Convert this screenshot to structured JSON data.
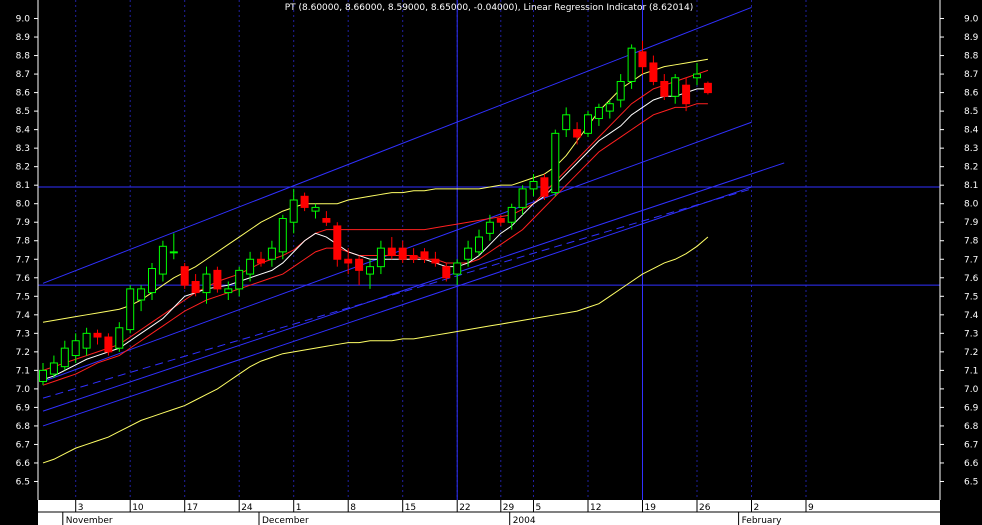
{
  "chart_data": {
    "type": "candlestick",
    "title": "PT (8.60000, 8.66000, 8.59000, 8.65000, -0.04000), Linear Regression Indicator (8.62014)",
    "ylim": [
      6.4,
      9.1
    ],
    "yticks": [
      6.5,
      6.6,
      6.7,
      6.8,
      6.9,
      7.0,
      7.1,
      7.2,
      7.3,
      7.4,
      7.5,
      7.6,
      7.7,
      7.8,
      7.9,
      8.0,
      8.1,
      8.2,
      8.3,
      8.4,
      8.5,
      8.6,
      8.7,
      8.8,
      8.9,
      9.0
    ],
    "ytick_labels": [
      "6.5",
      "6.6",
      "6.7",
      "6.8",
      "6.9",
      "7.0",
      "7.1",
      "7.2",
      "7.3",
      "7.4",
      "7.5",
      "7.6",
      "7.7",
      "7.8",
      "7.9",
      "8.0",
      "8.1",
      "8.2",
      "8.3",
      "8.4",
      "8.5",
      "8.6",
      "8.7",
      "8.8",
      "8.9",
      "9.0"
    ],
    "x_ticks": [
      {
        "label": "3",
        "index": 3
      },
      {
        "label": "10",
        "index": 8
      },
      {
        "label": "17",
        "index": 13
      },
      {
        "label": "24",
        "index": 18
      },
      {
        "label": "1",
        "index": 23
      },
      {
        "label": "8",
        "index": 28
      },
      {
        "label": "15",
        "index": 33
      },
      {
        "label": "22",
        "index": 38
      },
      {
        "label": "29",
        "index": 42
      },
      {
        "label": "5",
        "index": 45
      },
      {
        "label": "12",
        "index": 50
      },
      {
        "label": "19",
        "index": 55
      },
      {
        "label": "26",
        "index": 60
      },
      {
        "label": "2",
        "index": 65
      },
      {
        "label": "9",
        "index": 70
      }
    ],
    "months": [
      {
        "label": "November",
        "index": 2
      },
      {
        "label": "December",
        "index": 20
      },
      {
        "label": "2004",
        "index": 43
      },
      {
        "label": "February",
        "index": 64
      }
    ],
    "candles": [
      {
        "o": 7.04,
        "h": 7.14,
        "l": 7.02,
        "c": 7.1
      },
      {
        "o": 7.08,
        "h": 7.18,
        "l": 7.06,
        "c": 7.14
      },
      {
        "o": 7.12,
        "h": 7.26,
        "l": 7.1,
        "c": 7.22
      },
      {
        "o": 7.18,
        "h": 7.3,
        "l": 7.14,
        "c": 7.26
      },
      {
        "o": 7.22,
        "h": 7.33,
        "l": 7.18,
        "c": 7.3
      },
      {
        "o": 7.3,
        "h": 7.32,
        "l": 7.24,
        "c": 7.28
      },
      {
        "o": 7.28,
        "h": 7.3,
        "l": 7.18,
        "c": 7.2
      },
      {
        "o": 7.22,
        "h": 7.36,
        "l": 7.2,
        "c": 7.33
      },
      {
        "o": 7.32,
        "h": 7.56,
        "l": 7.3,
        "c": 7.54
      },
      {
        "o": 7.48,
        "h": 7.56,
        "l": 7.42,
        "c": 7.54
      },
      {
        "o": 7.52,
        "h": 7.68,
        "l": 7.48,
        "c": 7.65
      },
      {
        "o": 7.62,
        "h": 7.8,
        "l": 7.58,
        "c": 7.77
      },
      {
        "o": 7.74,
        "h": 7.84,
        "l": 7.7,
        "c": 7.74
      },
      {
        "o": 7.66,
        "h": 7.68,
        "l": 7.54,
        "c": 7.56
      },
      {
        "o": 7.58,
        "h": 7.62,
        "l": 7.5,
        "c": 7.52
      },
      {
        "o": 7.52,
        "h": 7.66,
        "l": 7.46,
        "c": 7.62
      },
      {
        "o": 7.64,
        "h": 7.66,
        "l": 7.52,
        "c": 7.54
      },
      {
        "o": 7.52,
        "h": 7.58,
        "l": 7.48,
        "c": 7.54
      },
      {
        "o": 7.54,
        "h": 7.66,
        "l": 7.5,
        "c": 7.64
      },
      {
        "o": 7.62,
        "h": 7.74,
        "l": 7.58,
        "c": 7.7
      },
      {
        "o": 7.7,
        "h": 7.74,
        "l": 7.66,
        "c": 7.68
      },
      {
        "o": 7.7,
        "h": 7.8,
        "l": 7.66,
        "c": 7.76
      },
      {
        "o": 7.74,
        "h": 7.94,
        "l": 7.7,
        "c": 7.92
      },
      {
        "o": 7.9,
        "h": 8.08,
        "l": 7.84,
        "c": 8.02
      },
      {
        "o": 8.04,
        "h": 8.06,
        "l": 7.96,
        "c": 7.98
      },
      {
        "o": 7.96,
        "h": 8.0,
        "l": 7.92,
        "c": 7.98
      },
      {
        "o": 7.92,
        "h": 7.96,
        "l": 7.88,
        "c": 7.9
      },
      {
        "o": 7.88,
        "h": 7.9,
        "l": 7.66,
        "c": 7.7
      },
      {
        "o": 7.7,
        "h": 7.76,
        "l": 7.62,
        "c": 7.68
      },
      {
        "o": 7.7,
        "h": 7.72,
        "l": 7.56,
        "c": 7.64
      },
      {
        "o": 7.62,
        "h": 7.7,
        "l": 7.54,
        "c": 7.66
      },
      {
        "o": 7.66,
        "h": 7.8,
        "l": 7.62,
        "c": 7.76
      },
      {
        "o": 7.76,
        "h": 7.82,
        "l": 7.7,
        "c": 7.72
      },
      {
        "o": 7.76,
        "h": 7.8,
        "l": 7.68,
        "c": 7.7
      },
      {
        "o": 7.72,
        "h": 7.76,
        "l": 7.68,
        "c": 7.7
      },
      {
        "o": 7.74,
        "h": 7.76,
        "l": 7.68,
        "c": 7.7
      },
      {
        "o": 7.7,
        "h": 7.74,
        "l": 7.66,
        "c": 7.68
      },
      {
        "o": 7.66,
        "h": 7.68,
        "l": 7.58,
        "c": 7.6
      },
      {
        "o": 7.62,
        "h": 7.7,
        "l": 7.56,
        "c": 7.68
      },
      {
        "o": 7.7,
        "h": 7.8,
        "l": 7.66,
        "c": 7.76
      },
      {
        "o": 7.74,
        "h": 7.86,
        "l": 7.72,
        "c": 7.82
      },
      {
        "o": 7.84,
        "h": 7.94,
        "l": 7.8,
        "c": 7.9
      },
      {
        "o": 7.92,
        "h": 7.94,
        "l": 7.88,
        "c": 7.9
      },
      {
        "o": 7.9,
        "h": 8.0,
        "l": 7.86,
        "c": 7.98
      },
      {
        "o": 7.98,
        "h": 8.1,
        "l": 7.94,
        "c": 8.08
      },
      {
        "o": 8.08,
        "h": 8.16,
        "l": 8.04,
        "c": 8.12
      },
      {
        "o": 8.14,
        "h": 8.16,
        "l": 8.02,
        "c": 8.04
      },
      {
        "o": 8.06,
        "h": 8.4,
        "l": 8.04,
        "c": 8.38
      },
      {
        "o": 8.4,
        "h": 8.52,
        "l": 8.36,
        "c": 8.48
      },
      {
        "o": 8.4,
        "h": 8.44,
        "l": 8.32,
        "c": 8.36
      },
      {
        "o": 8.38,
        "h": 8.5,
        "l": 8.36,
        "c": 8.48
      },
      {
        "o": 8.46,
        "h": 8.54,
        "l": 8.42,
        "c": 8.52
      },
      {
        "o": 8.5,
        "h": 8.56,
        "l": 8.46,
        "c": 8.54
      },
      {
        "o": 8.56,
        "h": 8.7,
        "l": 8.52,
        "c": 8.66
      },
      {
        "o": 8.66,
        "h": 8.86,
        "l": 8.62,
        "c": 8.84
      },
      {
        "o": 8.82,
        "h": 8.88,
        "l": 8.7,
        "c": 8.74
      },
      {
        "o": 8.76,
        "h": 8.8,
        "l": 8.64,
        "c": 8.66
      },
      {
        "o": 8.66,
        "h": 8.7,
        "l": 8.56,
        "c": 8.58
      },
      {
        "o": 8.58,
        "h": 8.7,
        "l": 8.54,
        "c": 8.68
      },
      {
        "o": 8.64,
        "h": 8.68,
        "l": 8.5,
        "c": 8.54
      },
      {
        "o": 8.68,
        "h": 8.76,
        "l": 8.64,
        "c": 8.7
      },
      {
        "o": 8.65,
        "h": 8.66,
        "l": 8.59,
        "c": 8.6
      }
    ],
    "ma_white": [
      7.05,
      7.07,
      7.1,
      7.13,
      7.16,
      7.18,
      7.2,
      7.22,
      7.26,
      7.3,
      7.34,
      7.38,
      7.44,
      7.5,
      7.52,
      7.54,
      7.55,
      7.56,
      7.58,
      7.6,
      7.62,
      7.64,
      7.68,
      7.74,
      7.8,
      7.84,
      7.82,
      7.78,
      7.74,
      7.72,
      7.7,
      7.7,
      7.7,
      7.7,
      7.7,
      7.7,
      7.68,
      7.66,
      7.66,
      7.68,
      7.72,
      7.78,
      7.84,
      7.88,
      7.94,
      8.0,
      8.04,
      8.1,
      8.16,
      8.22,
      8.28,
      8.34,
      8.38,
      8.42,
      8.48,
      8.52,
      8.56,
      8.58,
      8.58,
      8.6,
      8.62,
      8.62
    ],
    "ma_red": [
      7.02,
      7.04,
      7.06,
      7.08,
      7.11,
      7.14,
      7.16,
      7.18,
      7.22,
      7.26,
      7.3,
      7.34,
      7.38,
      7.42,
      7.45,
      7.48,
      7.5,
      7.52,
      7.54,
      7.56,
      7.58,
      7.6,
      7.62,
      7.66,
      7.7,
      7.74,
      7.76,
      7.76,
      7.74,
      7.72,
      7.72,
      7.72,
      7.72,
      7.72,
      7.72,
      7.7,
      7.7,
      7.68,
      7.68,
      7.68,
      7.7,
      7.74,
      7.78,
      7.82,
      7.86,
      7.92,
      7.98,
      8.04,
      8.1,
      8.16,
      8.22,
      8.28,
      8.32,
      8.36,
      8.4,
      8.44,
      8.48,
      8.5,
      8.52,
      8.52,
      8.54,
      8.54
    ],
    "ma_red_upper": [
      7.1,
      7.12,
      7.14,
      7.16,
      7.18,
      7.2,
      7.22,
      7.24,
      7.28,
      7.32,
      7.36,
      7.4,
      7.44,
      7.48,
      7.52,
      7.55,
      7.58,
      7.6,
      7.62,
      7.65,
      7.68,
      7.7,
      7.72,
      7.75,
      7.8,
      7.84,
      7.86,
      7.86,
      7.86,
      7.86,
      7.86,
      7.86,
      7.86,
      7.86,
      7.86,
      7.86,
      7.87,
      7.88,
      7.89,
      7.9,
      7.91,
      7.92,
      7.93,
      7.94,
      7.97,
      8.0,
      8.06,
      8.12,
      8.18,
      8.24,
      8.3,
      8.36,
      8.42,
      8.48,
      8.54,
      8.58,
      8.62,
      8.64,
      8.66,
      8.68,
      8.7,
      8.72
    ],
    "band_upper": [
      7.36,
      7.37,
      7.38,
      7.39,
      7.4,
      7.41,
      7.42,
      7.43,
      7.45,
      7.48,
      7.52,
      7.56,
      7.6,
      7.63,
      7.66,
      7.7,
      7.74,
      7.78,
      7.82,
      7.86,
      7.9,
      7.93,
      7.96,
      7.98,
      8.0,
      8.0,
      8.0,
      8.0,
      8.02,
      8.03,
      8.04,
      8.05,
      8.06,
      8.06,
      8.07,
      8.07,
      8.08,
      8.08,
      8.08,
      8.08,
      8.08,
      8.09,
      8.1,
      8.1,
      8.12,
      8.14,
      8.16,
      8.2,
      8.26,
      8.34,
      8.42,
      8.5,
      8.56,
      8.62,
      8.66,
      8.7,
      8.72,
      8.74,
      8.75,
      8.76,
      8.77,
      8.78
    ],
    "band_lower": [
      6.6,
      6.62,
      6.65,
      6.68,
      6.7,
      6.72,
      6.74,
      6.77,
      6.8,
      6.83,
      6.85,
      6.87,
      6.89,
      6.91,
      6.94,
      6.97,
      7.0,
      7.04,
      7.08,
      7.12,
      7.15,
      7.17,
      7.19,
      7.2,
      7.21,
      7.22,
      7.23,
      7.24,
      7.25,
      7.25,
      7.26,
      7.26,
      7.26,
      7.27,
      7.27,
      7.28,
      7.29,
      7.3,
      7.31,
      7.32,
      7.33,
      7.34,
      7.35,
      7.36,
      7.37,
      7.38,
      7.39,
      7.4,
      7.41,
      7.42,
      7.44,
      7.46,
      7.5,
      7.54,
      7.58,
      7.62,
      7.65,
      7.68,
      7.7,
      7.73,
      7.77,
      7.82
    ],
    "hlines": [
      8.09,
      7.56
    ],
    "vlines_index": [
      38,
      55
    ],
    "trendlines": [
      {
        "x0": 0,
        "y0": 7.57,
        "x1": 65,
        "y1": 9.06,
        "style": "solid"
      },
      {
        "x0": 0,
        "y0": 7.04,
        "x1": 65,
        "y1": 8.44,
        "style": "solid"
      },
      {
        "x0": 0,
        "y0": 6.88,
        "x1": 68,
        "y1": 8.22,
        "style": "solid"
      },
      {
        "x0": 0,
        "y0": 6.95,
        "x1": 65,
        "y1": 8.08,
        "style": "dashed"
      },
      {
        "x0": 0,
        "y0": 6.8,
        "x1": 65,
        "y1": 8.09,
        "style": "solid"
      }
    ],
    "colors": {
      "background": "#000000",
      "up": "#00ff00",
      "down": "#ff0000",
      "ma_white": "#ffffff",
      "ma_red": "#ff2020",
      "band": "#ffff66",
      "lines": "#3030ff",
      "grid": "#2020a0",
      "axis_panel": "#ffffff"
    },
    "grid": true
  }
}
